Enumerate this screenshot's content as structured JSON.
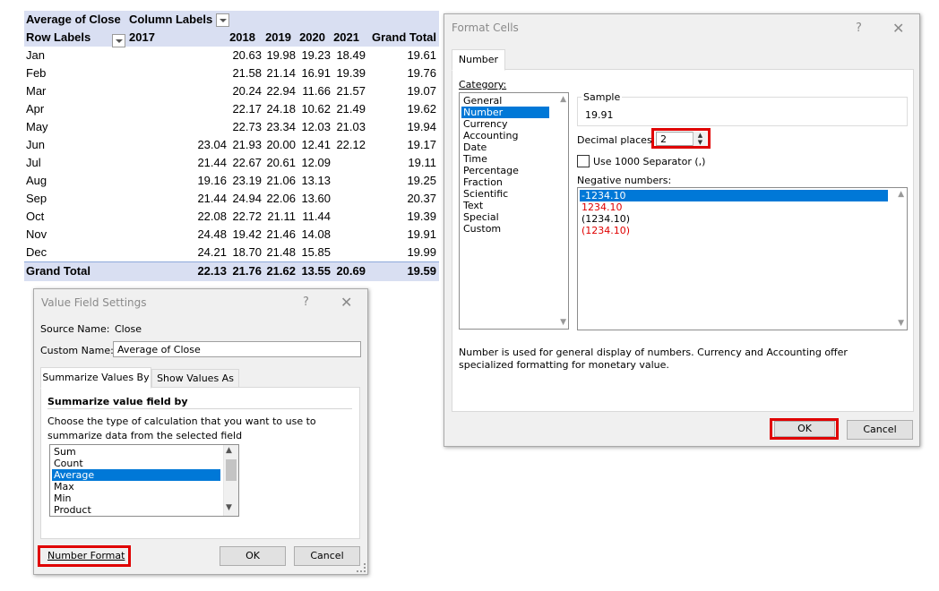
{
  "pivot": {
    "header1": {
      "value_label": "Average of  Close",
      "column_labels": "Column Labels"
    },
    "header2": {
      "row_labels": "Row Labels",
      "years": [
        "2017",
        "2018",
        "2019",
        "2020",
        "2021"
      ],
      "grand_total": "Grand Total"
    },
    "rows": [
      {
        "label": "Jan",
        "v": [
          "",
          "20.63",
          "19.98",
          "19.23",
          "18.49"
        ],
        "total": "19.61"
      },
      {
        "label": "Feb",
        "v": [
          "",
          "21.58",
          "21.14",
          "16.91",
          "19.39"
        ],
        "total": "19.76"
      },
      {
        "label": "Mar",
        "v": [
          "",
          "20.24",
          "22.94",
          "11.66",
          "21.57"
        ],
        "total": "19.07"
      },
      {
        "label": "Apr",
        "v": [
          "",
          "22.17",
          "24.18",
          "10.62",
          "21.49"
        ],
        "total": "19.62"
      },
      {
        "label": "May",
        "v": [
          "",
          "22.73",
          "23.34",
          "12.03",
          "21.03"
        ],
        "total": "19.94"
      },
      {
        "label": "Jun",
        "v": [
          "23.04",
          "21.93",
          "20.00",
          "12.41",
          "22.12"
        ],
        "total": "19.17"
      },
      {
        "label": "Jul",
        "v": [
          "21.44",
          "22.67",
          "20.61",
          "12.09",
          ""
        ],
        "total": "19.11"
      },
      {
        "label": "Aug",
        "v": [
          "19.16",
          "23.19",
          "21.06",
          "13.13",
          ""
        ],
        "total": "19.25"
      },
      {
        "label": "Sep",
        "v": [
          "21.44",
          "24.94",
          "22.06",
          "13.60",
          ""
        ],
        "total": "20.37"
      },
      {
        "label": "Oct",
        "v": [
          "22.08",
          "22.72",
          "21.11",
          "11.44",
          ""
        ],
        "total": "19.39"
      },
      {
        "label": "Nov",
        "v": [
          "24.48",
          "19.42",
          "21.46",
          "14.08",
          ""
        ],
        "total": "19.91"
      },
      {
        "label": "Dec",
        "v": [
          "24.21",
          "18.70",
          "21.48",
          "15.85",
          ""
        ],
        "total": "19.99"
      }
    ],
    "grand": {
      "label": "Grand Total",
      "v": [
        "22.13",
        "21.76",
        "21.62",
        "13.55",
        "20.69"
      ],
      "total": "19.59"
    }
  },
  "vfs": {
    "title": "Value Field Settings",
    "help": "?",
    "close": "✕",
    "source_name_label": "Source Name:",
    "source_name_value": "Close",
    "custom_name_label": "Custom Name:",
    "custom_name_value": "Average of  Close",
    "tabs": [
      "Summarize Values By",
      "Show Values As"
    ],
    "section_title": "Summarize value field by",
    "description": "Choose the type of calculation that you want to use to summarize data from the selected field",
    "list": [
      "Sum",
      "Count",
      "Average",
      "Max",
      "Min",
      "Product"
    ],
    "selected": "Average",
    "number_format": "Number Format",
    "ok": "OK",
    "cancel": "Cancel"
  },
  "fc": {
    "title": "Format Cells",
    "help": "?",
    "close": "✕",
    "tab": "Number",
    "category_label": "Category:",
    "categories": [
      "General",
      "Number",
      "Currency",
      "Accounting",
      "Date",
      "Time",
      "Percentage",
      "Fraction",
      "Scientific",
      "Text",
      "Special",
      "Custom"
    ],
    "selected_category": "Number",
    "sample_label": "Sample",
    "sample_value": "19.91",
    "decimal_label": "Decimal places:",
    "decimal_value": "2",
    "separator_label": "Use 1000 Separator (,)",
    "negative_label": "Negative numbers:",
    "negatives": [
      {
        "text": "-1234.10",
        "color": "#ffffff",
        "selected": true
      },
      {
        "text": "1234.10",
        "color": "#e00000"
      },
      {
        "text": "(1234.10)",
        "color": "#000000"
      },
      {
        "text": "(1234.10)",
        "color": "#e00000"
      }
    ],
    "description": "Number is used for general display of numbers.  Currency and Accounting offer specialized formatting for monetary value.",
    "ok": "OK",
    "cancel": "Cancel"
  },
  "colors": {
    "highlight": "#e00000",
    "selection": "#0078d7",
    "pivot_header": "#d9dff2"
  }
}
